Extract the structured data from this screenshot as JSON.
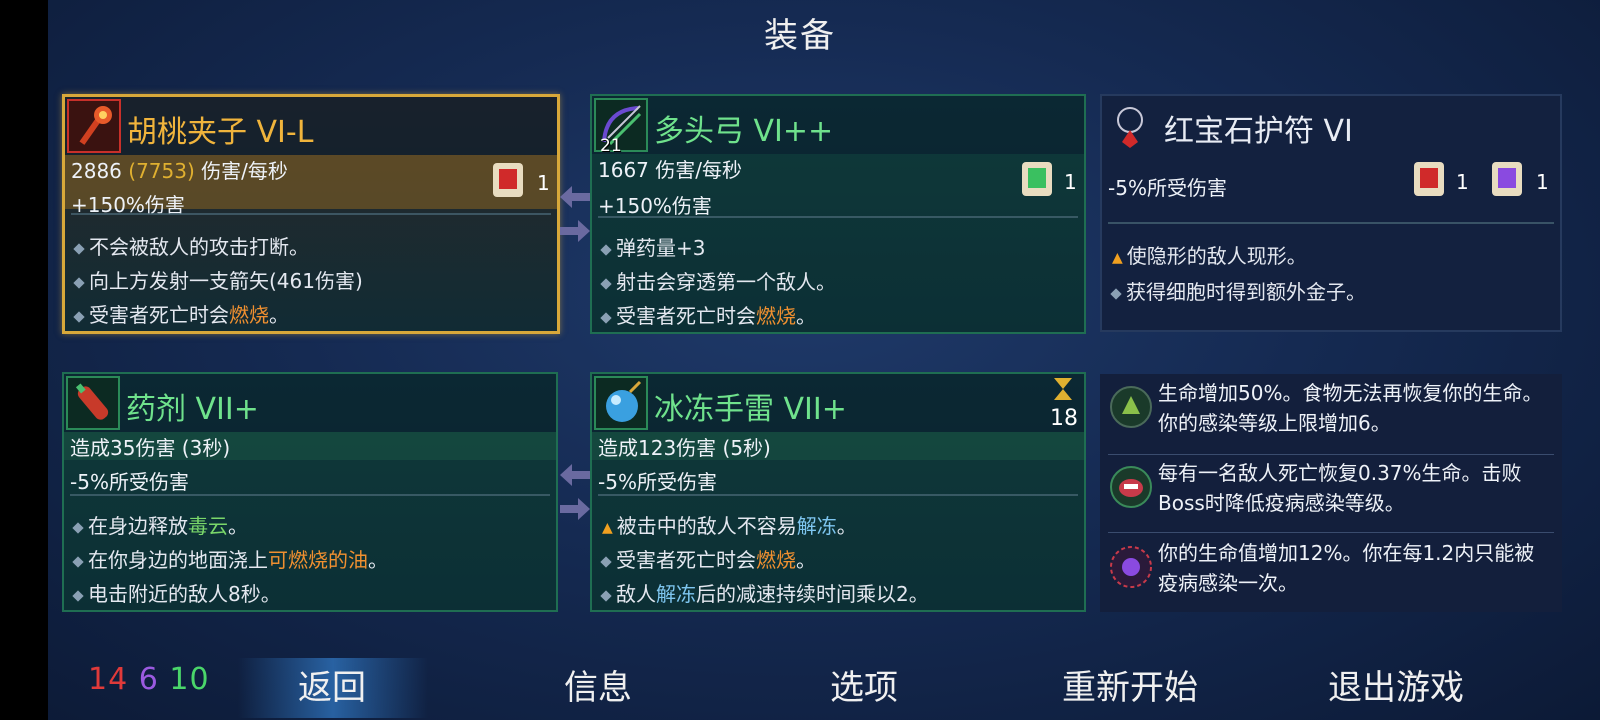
{
  "screen": {
    "title": "装备"
  },
  "weapons": [
    {
      "name": "胡桃夹子 VI-L",
      "dps_base": "2886",
      "dps_crit": "(7753)",
      "dps_unit": "伤害/每秒",
      "bonus": "+150%伤害",
      "scroll_count": "1",
      "effects": [
        "不会被敌人的攻击打断。",
        "向上方发射一支箭矢(461伤害)",
        "受害者死亡时会",
        "燃烧",
        "。"
      ]
    },
    {
      "name": "多头弓 VI++",
      "icon_count": "21",
      "dps_base": "1667",
      "dps_unit": "伤害/每秒",
      "bonus": "+150%伤害",
      "scroll_count": "1",
      "effects": [
        "弹药量+3",
        "射击会穿透第一个敌人。",
        "受害者死亡时会",
        "燃烧",
        "。"
      ]
    }
  ],
  "amulet": {
    "name": "红宝石护符 VI",
    "stat": "-5%所受伤害",
    "scroll_red_count": "1",
    "scroll_purple_count": "1",
    "effects": [
      "使隐形的敌人现形。",
      "获得细胞时得到额外金子。"
    ]
  },
  "skills": [
    {
      "name": "药剂 VII+",
      "stat1": "造成35伤害 (3秒)",
      "stat2": "-5%所受伤害",
      "effects": [
        "在身边释放",
        "毒云",
        "。",
        "在你身边的地面浇上",
        "可燃烧的油",
        "。",
        "电击附近的敌人8秒。"
      ]
    },
    {
      "name": "冰冻手雷 VII+",
      "stat1": "造成123伤害 (5秒)",
      "stat2": "-5%所受伤害",
      "cooldown": "18",
      "effects": [
        "被击中的敌人不容易",
        "解冻",
        "。",
        "受害者死亡时会",
        "燃烧",
        "。",
        "敌人",
        "解冻",
        "后的减速持续时间乘以2。"
      ]
    }
  ],
  "mutations": [
    {
      "text": "生命增加50%。食物无法再恢复你的生命。你的感染等级上限增加6。"
    },
    {
      "text": "每有一名敌人死亡恢复0.37%生命。击败Boss时降低疫病感染等级。"
    },
    {
      "text": "你的生命值增加12%。你在每1.2内只能被疫病感染一次。"
    }
  ],
  "stats": {
    "brutality": "14",
    "tactics": "6",
    "survival": "10"
  },
  "menu": {
    "back": "返回",
    "info": "信息",
    "options": "选项",
    "restart": "重新开始",
    "quit": "退出游戏"
  },
  "colors": {
    "brutality": "#e03a3a",
    "tactics": "#9a5ae0",
    "survival": "#4ad66a",
    "selected_border": "#d8a83a"
  }
}
